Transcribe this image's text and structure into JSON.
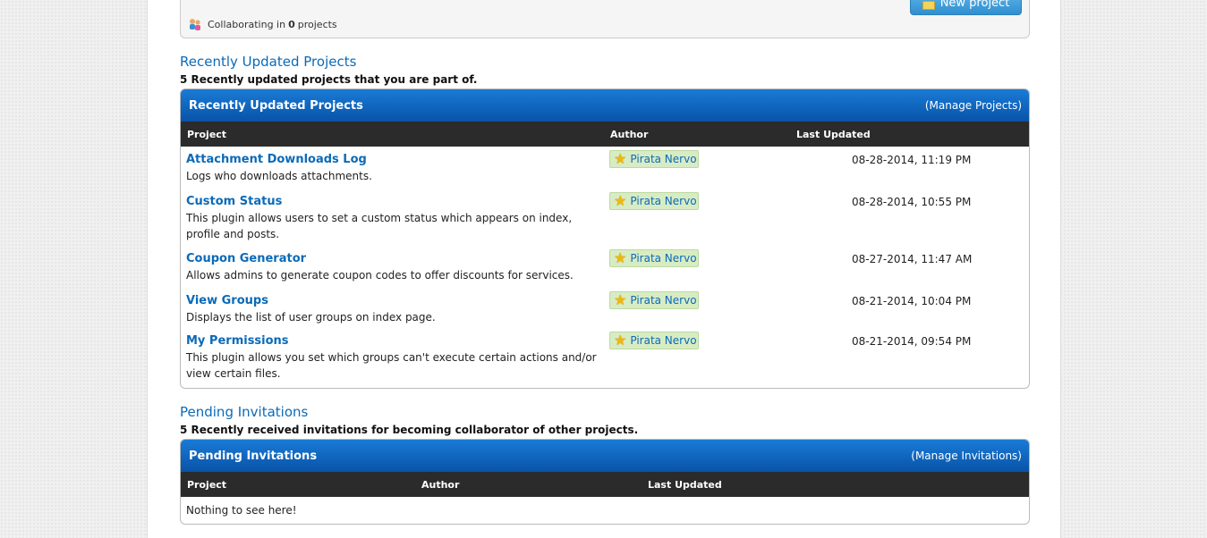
{
  "collab": {
    "prefix": "Collaborating in",
    "count": "0",
    "suffix": "projects",
    "new_project_label": "New project"
  },
  "recent": {
    "title": "Recently Updated Projects",
    "subtitle": "5 Recently updated projects that you are part of.",
    "box_title": "Recently Updated Projects",
    "manage_label": "(Manage Projects)",
    "columns": [
      "Project",
      "Author",
      "Last Updated"
    ],
    "rows": [
      {
        "name": "Attachment Downloads Log",
        "desc": "Logs who downloads attachments.",
        "author": "Pirata Nervo",
        "date": "08-28-2014, 11:19 PM"
      },
      {
        "name": "Custom Status",
        "desc": "This plugin allows users to set a custom status which appears on index, profile and posts.",
        "author": "Pirata Nervo",
        "date": "08-28-2014, 10:55 PM"
      },
      {
        "name": "Coupon Generator",
        "desc": "Allows admins to generate coupon codes to offer discounts for services.",
        "author": "Pirata Nervo",
        "date": "08-27-2014, 11:47 AM"
      },
      {
        "name": "View Groups",
        "desc": "Displays the list of user groups on index page.",
        "author": "Pirata Nervo",
        "date": "08-21-2014, 10:04 PM"
      },
      {
        "name": "My Permissions",
        "desc": "This plugin allows you set which groups can't execute certain actions and/or view certain files.",
        "author": "Pirata Nervo",
        "date": "08-21-2014, 09:54 PM"
      }
    ]
  },
  "pending": {
    "title": "Pending Invitations",
    "subtitle": "5 Recently received invitations for becoming collaborator of other projects.",
    "box_title": "Pending Invitations",
    "manage_label": "(Manage Invitations)",
    "columns": [
      "Project",
      "Author",
      "Last Updated"
    ],
    "empty_text": "Nothing to see here!"
  },
  "colors": {
    "link": "#0b6ab8",
    "header_blue": "#0853a8",
    "badge_bg": "#d8ecc4"
  }
}
